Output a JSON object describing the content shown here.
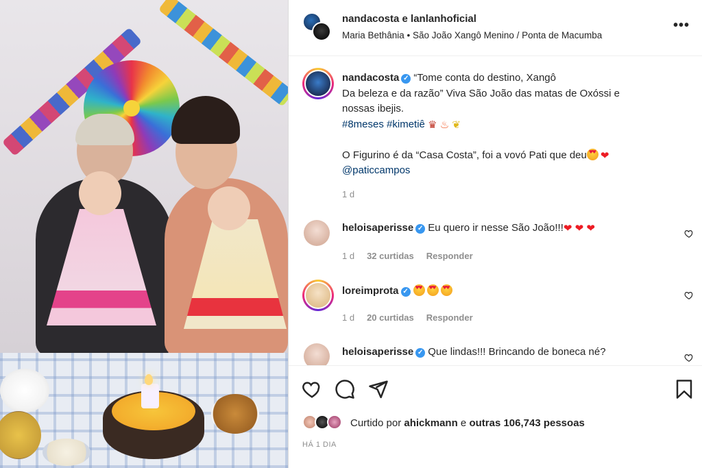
{
  "post": {
    "header": {
      "title": "nandacosta e lanlanhoficial",
      "subtitle": "Maria Bethânia • São João Xangô Menino / Ponta de Macumba",
      "more_icon": "more-options-icon"
    },
    "caption": {
      "username": "nandacosta",
      "line1": "“Tome conta do destino, Xangô",
      "line2": "Da beleza e da razão” Viva São João das matas de Oxóssi e",
      "line3": "nossas ibejis.",
      "hashtags": "#8meses #kimetiê",
      "line5": "O Figurino é da “Casa Costa”, foi a vovó Pati que deu",
      "mention": "@paticcampos",
      "time": "1 d"
    },
    "comments": [
      {
        "username": "heloisaperisse",
        "text": "Eu quero ir nesse São João!!!",
        "time": "1 d",
        "likes": "32 curtidas",
        "reply": "Responder"
      },
      {
        "username": "loreimprota",
        "text": "",
        "time": "1 d",
        "likes": "20 curtidas",
        "reply": "Responder"
      },
      {
        "username": "heloisaperisse",
        "text": "Que lindas!!! Brincando de boneca né?"
      }
    ],
    "likes": {
      "prefix": "Curtido por",
      "user": "ahickmann",
      "middle": "e",
      "others": "outras 106,743 pessoas"
    },
    "date": "HÁ 1 DIA",
    "icons": {
      "like": "heart-icon",
      "comment": "comment-icon",
      "share": "share-icon",
      "save": "bookmark-icon"
    },
    "colors": {
      "link": "#00376b",
      "verified": "#3897f0",
      "meta": "#8e8e8e",
      "text": "#262626"
    }
  }
}
